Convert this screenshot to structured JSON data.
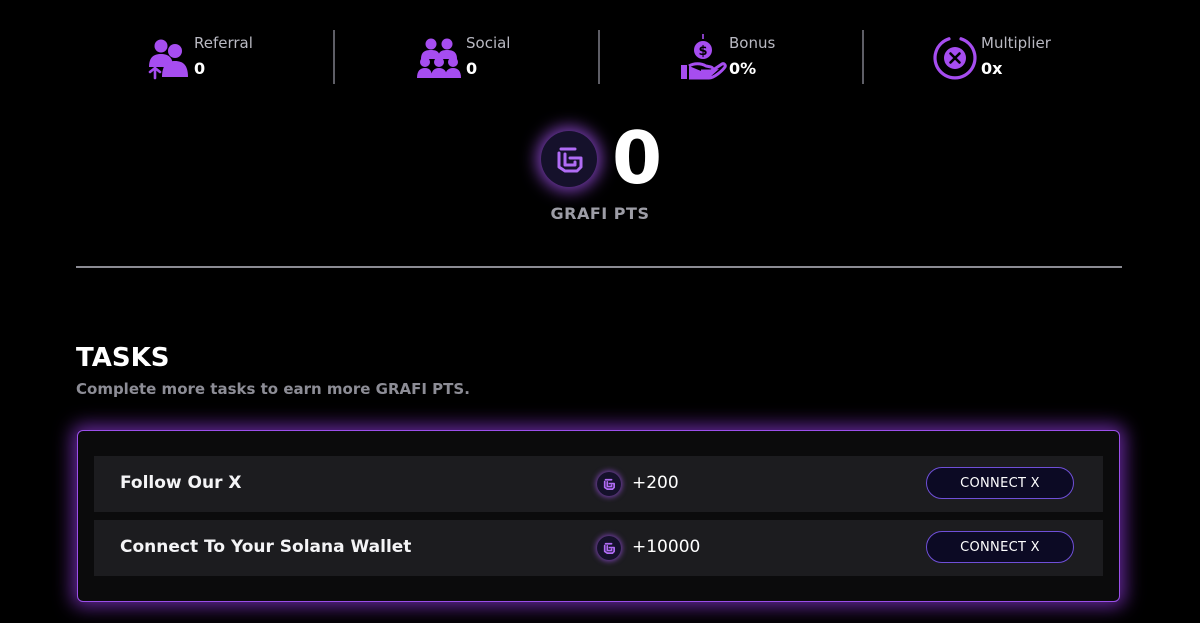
{
  "colors": {
    "background": "#000000",
    "accent": "#a855f7",
    "icon_purple": "#a64df0",
    "button_border": "#6f4fd8"
  },
  "stats": [
    {
      "label": "Referral",
      "value": "0",
      "icon": "referral-users-icon"
    },
    {
      "label": "Social",
      "value": "0",
      "icon": "social-group-icon"
    },
    {
      "label": "Bonus",
      "value": "0%",
      "icon": "bonus-money-hand-icon"
    },
    {
      "label": "Multiplier",
      "value": "0x",
      "icon": "multiplier-x-icon"
    }
  ],
  "points": {
    "value": "0",
    "label": "GRAFI PTS",
    "icon": "grafi-logo-icon"
  },
  "tasks": {
    "title": "TASKS",
    "subtitle": "Complete more tasks to earn more GRAFI PTS.",
    "items": [
      {
        "name": "Follow Our X",
        "reward": "+200",
        "button_label": "CONNECT X"
      },
      {
        "name": "Connect To Your Solana Wallet",
        "reward": "+10000",
        "button_label": "CONNECT X"
      }
    ]
  }
}
